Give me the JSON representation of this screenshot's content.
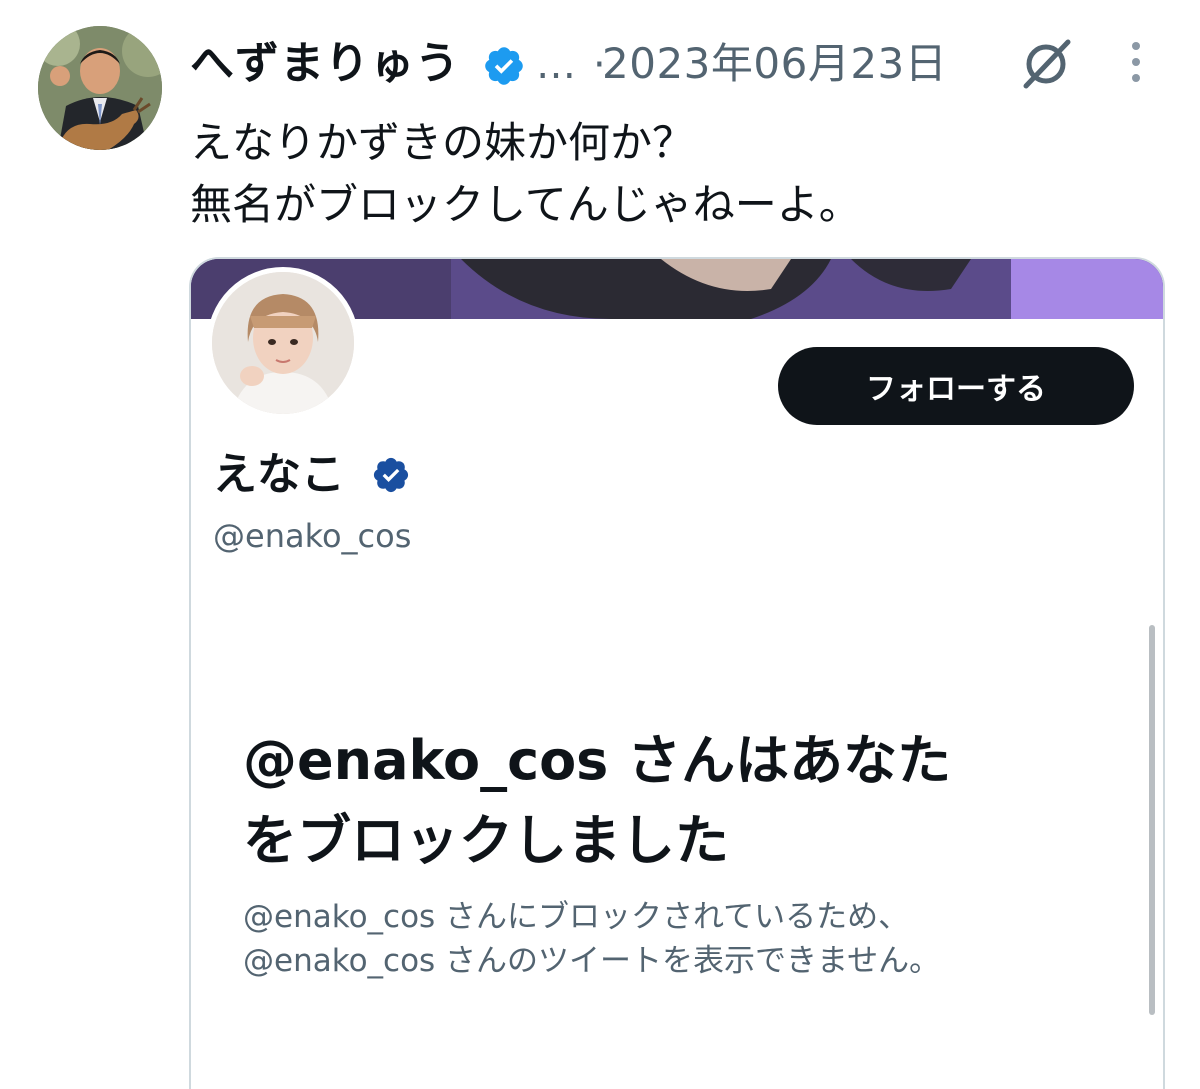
{
  "tweet": {
    "author_name": "へずまりゅう",
    "author_verified": true,
    "handle_truncated": "…",
    "separator": "·",
    "date": "2023年06月23日",
    "text_lines": [
      "えなりかずきの妹か何か？",
      "無名がブロックしてんじゃねーよ。"
    ]
  },
  "icons": {
    "verified": "verified-badge-icon",
    "grok": "grok-icon",
    "more": "more-vertical-icon"
  },
  "embedded_profile": {
    "follow_label": "フォローする",
    "display_name": "えなこ",
    "verified": true,
    "handle": "@enako_cos",
    "blocked_title_lines": [
      "@enako_cos さんはあなた",
      "をブロックしました"
    ],
    "blocked_desc_lines": [
      "@enako_cos さんにブロックされているため、",
      "@enako_cos さんのツイートを表示できません。"
    ]
  },
  "colors": {
    "text_primary": "#0f1419",
    "text_secondary": "#536471",
    "verified_blue": "#1d9bf0",
    "button_dark": "#0f1419",
    "border": "#cfd9de"
  }
}
